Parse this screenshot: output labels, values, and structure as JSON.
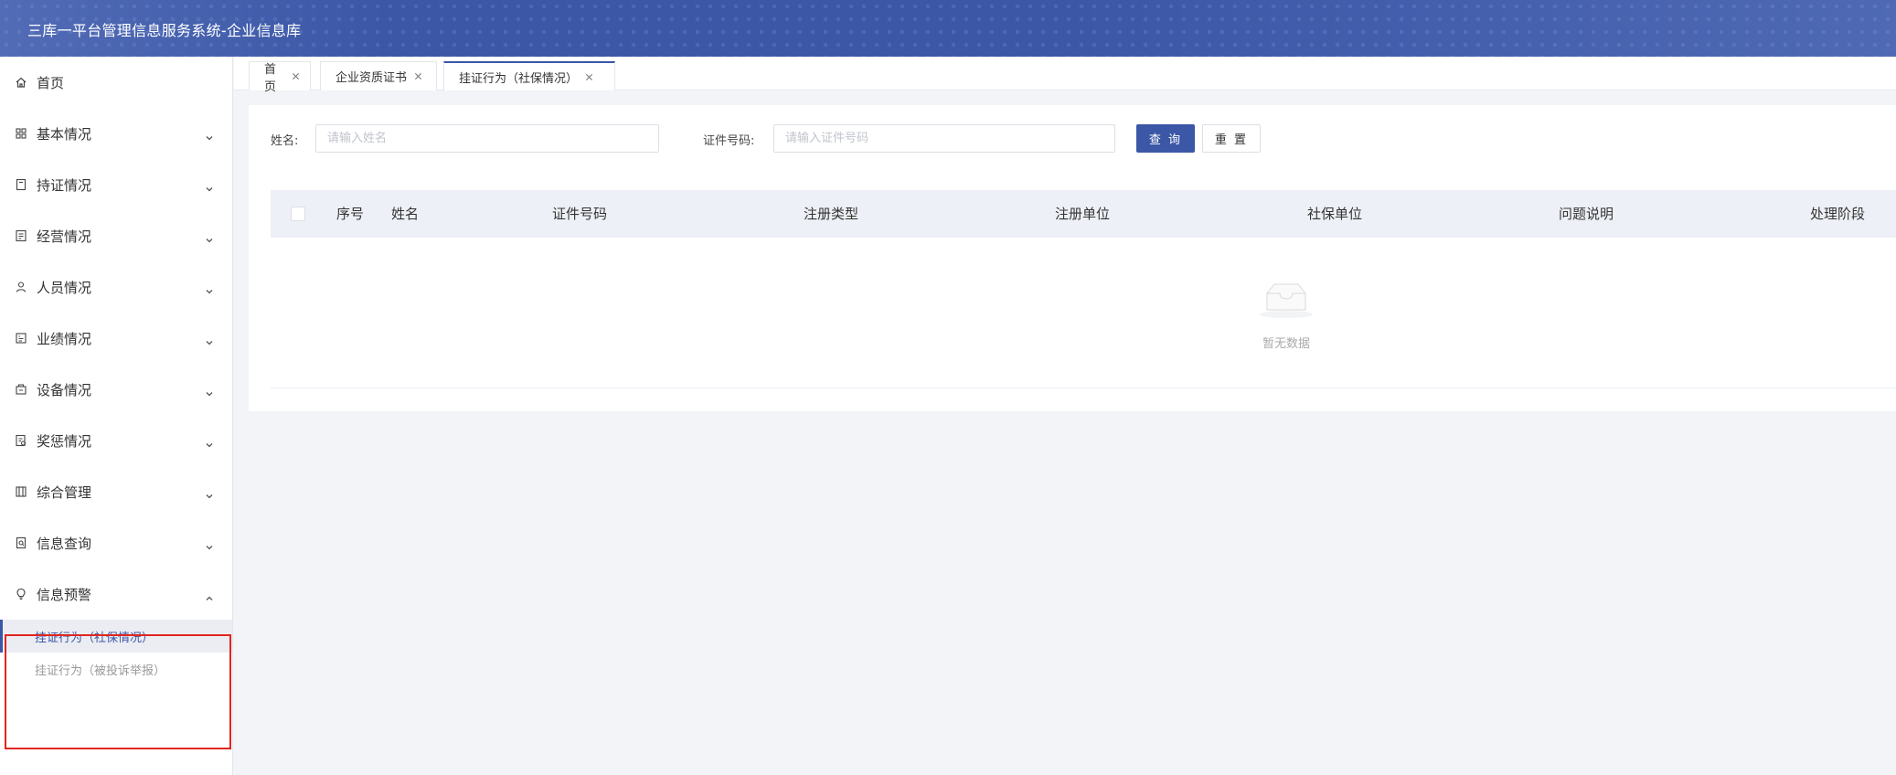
{
  "header": {
    "title": "三库一平台管理信息服务系统-企业信息库",
    "bg_color": "#3b57a6"
  },
  "sidebar": {
    "items": [
      {
        "label": "首页",
        "icon": "home-icon"
      },
      {
        "label": "基本情况",
        "icon": "grid-icon",
        "expanded": false
      },
      {
        "label": "持证情况",
        "icon": "certificate-icon",
        "expanded": false
      },
      {
        "label": "经营情况",
        "icon": "business-icon",
        "expanded": false
      },
      {
        "label": "人员情况",
        "icon": "user-icon",
        "expanded": false
      },
      {
        "label": "业绩情况",
        "icon": "chart-icon",
        "expanded": false
      },
      {
        "label": "设备情况",
        "icon": "equipment-icon",
        "expanded": false
      },
      {
        "label": "奖惩情况",
        "icon": "award-icon",
        "expanded": false
      },
      {
        "label": "综合管理",
        "icon": "manage-icon",
        "expanded": false
      },
      {
        "label": "信息查询",
        "icon": "query-icon",
        "expanded": false
      },
      {
        "label": "信息预警",
        "icon": "bulb-icon",
        "expanded": true
      }
    ],
    "submenu": [
      {
        "label": "挂证行为（社保情况）",
        "active": true
      },
      {
        "label": "挂证行为（被投诉举报）",
        "active": false
      }
    ],
    "highlight_color": "#e0261f"
  },
  "tabs": [
    {
      "label": "首页",
      "active": false
    },
    {
      "label": "企业资质证书",
      "active": false
    },
    {
      "label": "挂证行为（社保情况）",
      "active": true
    }
  ],
  "search": {
    "name_label": "姓名:",
    "name_placeholder": "请输入姓名",
    "id_label": "证件号码:",
    "id_placeholder": "请输入证件号码",
    "query_button": "查 询",
    "reset_button": "重 置"
  },
  "table": {
    "columns": [
      "序号",
      "姓名",
      "证件号码",
      "注册类型",
      "注册单位",
      "社保单位",
      "问题说明",
      "处理阶段"
    ],
    "rows": [],
    "empty_text": "暂无数据"
  }
}
